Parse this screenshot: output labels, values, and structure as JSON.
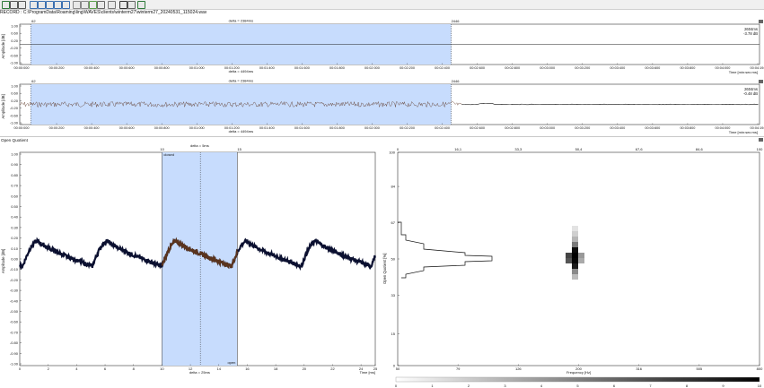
{
  "toolbar": {
    "icons": [
      "new-icon",
      "save-icon",
      "print-icon",
      "zoom-in-icon",
      "zoom-out-icon",
      "zoom-fit-icon",
      "zoom-vertical-icon",
      "zoom-horizontal-icon",
      "select-icon",
      "cut-icon",
      "marker-icon",
      "settings-icon",
      "page-icon",
      "play-icon",
      "bookmark-icon",
      "search-icon"
    ]
  },
  "record": {
    "label": "RECORD :",
    "path": "C:\\ProgramData\\Roaming\\ling\\WAVES\\clients\\winterm27\\winterm27_20240531_115024.wav"
  },
  "trace1": {
    "ylabel": "Amplitude [dB]",
    "yticks": [
      "1.00",
      "0.60",
      "0.20",
      "-0.20",
      "-0.60",
      "-1.00"
    ],
    "cursor_left": "62",
    "cursor_right": "2446",
    "delta_top": "delta = 2384ms",
    "delta_bottom": "delta = 4494ms",
    "readout_time": "2604ms",
    "readout_value": "-3.78 dB",
    "xlabel": "Time [min:sec:ms]",
    "xticks": [
      "00:00:000",
      "00:00:200",
      "00:00:400",
      "00:00:600",
      "00:00:800",
      "00:01:000",
      "00:01:200",
      "00:01:400",
      "00:01:600",
      "00:01:800",
      "00:02:000",
      "00:02:200",
      "00:02:400",
      "00:02:600",
      "00:02:800",
      "00:03:000",
      "00:03:200",
      "00:03:400",
      "00:03:600",
      "00:03:800",
      "00:04:000",
      "00:04:194"
    ]
  },
  "trace2": {
    "ylabel": "Amplitude [dB]",
    "yticks": [
      "1.00",
      "0.60",
      "0.20",
      "-0.20",
      "-0.60",
      "-1.00"
    ],
    "cursor_left": "62",
    "cursor_right": "2446",
    "delta_top": "delta = 2384ms",
    "delta_bottom": "delta = 4494ms",
    "readout_time": "2604ms",
    "readout_value": "-0.48 dB",
    "xlabel": "Time [min:sec:ms]",
    "xticks": [
      "00:00:000",
      "00:00:200",
      "00:00:400",
      "00:00:600",
      "00:00:800",
      "00:01:000",
      "00:01:200",
      "00:01:400",
      "00:01:600",
      "00:01:800",
      "00:02:000",
      "00:02:200",
      "00:02:400",
      "00:02:600",
      "00:02:800",
      "00:03:000",
      "00:03:200",
      "00:03:400",
      "00:03:600",
      "00:03:800",
      "00:04:000",
      "00:04:194"
    ]
  },
  "og": {
    "section_title": "Open Quotient",
    "ylabel": "Amplitude [dB]",
    "yticks": [
      "1.00",
      "0.90",
      "0.80",
      "0.70",
      "0.60",
      "0.50",
      "0.40",
      "0.30",
      "0.20",
      "0.10",
      "0.00",
      "-0.10",
      "-0.20",
      "-0.30",
      "-0.40",
      "-0.50",
      "-0.60",
      "-0.70",
      "-0.80",
      "-0.90",
      "-1.00"
    ],
    "xticks": [
      "0",
      "2",
      "4",
      "6",
      "8",
      "10",
      "12",
      "14",
      "16",
      "18",
      "20",
      "22",
      "24",
      "25"
    ],
    "xlabel": "Time [ms]",
    "cursor_left": "10",
    "cursor_right": "15",
    "delta_top": "delta = 5ms",
    "delta_bottom": "delta = 25ms",
    "closed_label": "closed",
    "open_label": "open"
  },
  "hist": {
    "ylabel": "Open Quotient [%]",
    "yticks": [
      "100",
      "84",
      "67",
      "50",
      "33",
      "15",
      "0"
    ],
    "top_ticks": [
      "0",
      "16,1",
      "33,3",
      "50,4",
      "67,6",
      "84,6",
      "100"
    ],
    "xticks": [
      "50",
      "79",
      "126",
      "200",
      "316",
      "505",
      "800"
    ],
    "xlabel": "Frequency [Hz]"
  },
  "colorbar": {
    "ticks": [
      "0",
      "1",
      "2",
      "3",
      "4",
      "5",
      "6",
      "7",
      "8",
      "9",
      "10"
    ]
  },
  "colors": {
    "selection": "#c7dcfd",
    "trace": "#111111",
    "trace2_sel": "#5b3422",
    "og_wave": "#0b1030",
    "og_sel": "#5a341e"
  }
}
